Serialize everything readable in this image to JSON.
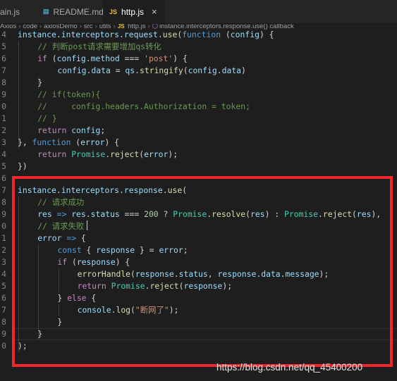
{
  "tabs": [
    {
      "label": "ain.js",
      "icon": "",
      "active": false
    },
    {
      "label": "README.md",
      "icon": "md-file-icon",
      "active": false
    },
    {
      "label": "http.js",
      "icon": "js-file-icon",
      "active": true
    }
  ],
  "tab_icon_text": {
    "md": "▤",
    "js": "JS"
  },
  "close_glyph": "×",
  "breadcrumb": [
    "Axios",
    "code",
    "axiosDemo",
    "src",
    "utils",
    "http.js",
    "instance.interceptors.response.use() callback"
  ],
  "code_lines": [
    {
      "num": "4",
      "indent": 0,
      "tokens": [
        [
          "v",
          "instance"
        ],
        [
          "p",
          "."
        ],
        [
          "v",
          "interceptors"
        ],
        [
          "p",
          "."
        ],
        [
          "v",
          "request"
        ],
        [
          "p",
          "."
        ],
        [
          "f",
          "use"
        ],
        [
          "p",
          "("
        ],
        [
          "k",
          "function"
        ],
        [
          "p",
          " ("
        ],
        [
          "v",
          "config"
        ],
        [
          "p",
          ") {"
        ]
      ]
    },
    {
      "num": "5",
      "indent": 1,
      "tokens": [
        [
          "cm",
          "// 判断post请求需要增加qs转化"
        ]
      ]
    },
    {
      "num": "6",
      "indent": 1,
      "tokens": [
        [
          "c",
          "if"
        ],
        [
          "p",
          " ("
        ],
        [
          "v",
          "config"
        ],
        [
          "p",
          "."
        ],
        [
          "v",
          "method"
        ],
        [
          "p",
          " === "
        ],
        [
          "s",
          "'post'"
        ],
        [
          "p",
          ") {"
        ]
      ]
    },
    {
      "num": "7",
      "indent": 2,
      "tokens": [
        [
          "v",
          "config"
        ],
        [
          "p",
          "."
        ],
        [
          "v",
          "data"
        ],
        [
          "p",
          " = "
        ],
        [
          "v",
          "qs"
        ],
        [
          "p",
          "."
        ],
        [
          "f",
          "stringify"
        ],
        [
          "p",
          "("
        ],
        [
          "v",
          "config"
        ],
        [
          "p",
          "."
        ],
        [
          "v",
          "data"
        ],
        [
          "p",
          ")"
        ]
      ]
    },
    {
      "num": "8",
      "indent": 1,
      "tokens": [
        [
          "p",
          "}"
        ]
      ]
    },
    {
      "num": "9",
      "indent": 1,
      "tokens": [
        [
          "cm",
          "// if(token){"
        ]
      ]
    },
    {
      "num": "0",
      "indent": 1,
      "tokens": [
        [
          "cm",
          "//     config.headers.Authorization = token;"
        ]
      ]
    },
    {
      "num": "1",
      "indent": 1,
      "tokens": [
        [
          "cm",
          "// }"
        ]
      ]
    },
    {
      "num": "2",
      "indent": 1,
      "tokens": [
        [
          "c",
          "return"
        ],
        [
          "p",
          " "
        ],
        [
          "v",
          "config"
        ],
        [
          "p",
          ";"
        ]
      ]
    },
    {
      "num": "3",
      "indent": 0,
      "tokens": [
        [
          "p",
          "}, "
        ],
        [
          "k",
          "function"
        ],
        [
          "p",
          " ("
        ],
        [
          "v",
          "error"
        ],
        [
          "p",
          ") {"
        ]
      ]
    },
    {
      "num": "4",
      "indent": 1,
      "tokens": [
        [
          "c",
          "return"
        ],
        [
          "p",
          " "
        ],
        [
          "cl",
          "Promise"
        ],
        [
          "p",
          "."
        ],
        [
          "f",
          "reject"
        ],
        [
          "p",
          "("
        ],
        [
          "v",
          "error"
        ],
        [
          "p",
          ");"
        ]
      ]
    },
    {
      "num": "5",
      "indent": 0,
      "tokens": [
        [
          "p",
          "})"
        ]
      ]
    },
    {
      "num": "6",
      "indent": 0,
      "tokens": []
    },
    {
      "num": "7",
      "indent": 0,
      "tokens": [
        [
          "v",
          "instance"
        ],
        [
          "p",
          "."
        ],
        [
          "v",
          "interceptors"
        ],
        [
          "p",
          "."
        ],
        [
          "v",
          "response"
        ],
        [
          "p",
          "."
        ],
        [
          "f",
          "use"
        ],
        [
          "p",
          "("
        ]
      ]
    },
    {
      "num": "8",
      "indent": 1,
      "tokens": [
        [
          "cm",
          "// 请求成功"
        ]
      ]
    },
    {
      "num": "9",
      "indent": 1,
      "tokens": [
        [
          "v",
          "res"
        ],
        [
          "p",
          " "
        ],
        [
          "k",
          "=>"
        ],
        [
          "p",
          " "
        ],
        [
          "v",
          "res"
        ],
        [
          "p",
          "."
        ],
        [
          "v",
          "status"
        ],
        [
          "p",
          " === "
        ],
        [
          "n",
          "200"
        ],
        [
          "p",
          " ? "
        ],
        [
          "cl",
          "Promise"
        ],
        [
          "p",
          "."
        ],
        [
          "f",
          "resolve"
        ],
        [
          "p",
          "("
        ],
        [
          "v",
          "res"
        ],
        [
          "p",
          ") : "
        ],
        [
          "cl",
          "Promise"
        ],
        [
          "p",
          "."
        ],
        [
          "f",
          "reject"
        ],
        [
          "p",
          "("
        ],
        [
          "v",
          "res"
        ],
        [
          "p",
          "),"
        ]
      ]
    },
    {
      "num": "0",
      "indent": 1,
      "tokens": [
        [
          "cm",
          "// 请求失败"
        ]
      ]
    },
    {
      "num": "1",
      "indent": 1,
      "tokens": [
        [
          "v",
          "error"
        ],
        [
          "p",
          " "
        ],
        [
          "k",
          "=>"
        ],
        [
          "p",
          " {"
        ]
      ]
    },
    {
      "num": "2",
      "indent": 2,
      "tokens": [
        [
          "k",
          "const"
        ],
        [
          "p",
          " { "
        ],
        [
          "v",
          "response"
        ],
        [
          "p",
          " } = "
        ],
        [
          "v",
          "error"
        ],
        [
          "p",
          ";"
        ]
      ]
    },
    {
      "num": "3",
      "indent": 2,
      "tokens": [
        [
          "c",
          "if"
        ],
        [
          "p",
          " ("
        ],
        [
          "v",
          "response"
        ],
        [
          "p",
          ") {"
        ]
      ]
    },
    {
      "num": "4",
      "indent": 3,
      "tokens": [
        [
          "f",
          "errorHandle"
        ],
        [
          "p",
          "("
        ],
        [
          "v",
          "response"
        ],
        [
          "p",
          "."
        ],
        [
          "v",
          "status"
        ],
        [
          "p",
          ", "
        ],
        [
          "v",
          "response"
        ],
        [
          "p",
          "."
        ],
        [
          "v",
          "data"
        ],
        [
          "p",
          "."
        ],
        [
          "v",
          "message"
        ],
        [
          "p",
          ");"
        ]
      ]
    },
    {
      "num": "5",
      "indent": 3,
      "tokens": [
        [
          "c",
          "return"
        ],
        [
          "p",
          " "
        ],
        [
          "cl",
          "Promise"
        ],
        [
          "p",
          "."
        ],
        [
          "f",
          "reject"
        ],
        [
          "p",
          "("
        ],
        [
          "v",
          "response"
        ],
        [
          "p",
          ");"
        ]
      ]
    },
    {
      "num": "6",
      "indent": 2,
      "tokens": [
        [
          "p",
          "} "
        ],
        [
          "c",
          "else"
        ],
        [
          "p",
          " {"
        ]
      ]
    },
    {
      "num": "7",
      "indent": 3,
      "tokens": [
        [
          "v",
          "console"
        ],
        [
          "p",
          "."
        ],
        [
          "f",
          "log"
        ],
        [
          "p",
          "("
        ],
        [
          "s",
          "\"断网了\""
        ],
        [
          "p",
          ");"
        ]
      ]
    },
    {
      "num": "8",
      "indent": 2,
      "tokens": [
        [
          "p",
          "}"
        ]
      ]
    },
    {
      "num": "9",
      "indent": 1,
      "tokens": [
        [
          "p",
          "}"
        ]
      ]
    },
    {
      "num": "0",
      "indent": 0,
      "tokens": [
        [
          "p",
          ");"
        ]
      ]
    }
  ],
  "watermark": "https://blog.csdn.net/qq_45400200",
  "colors": {
    "background": "#1e1e1e",
    "tabbar": "#252526",
    "highlight_box": "#f2262c",
    "keyword": "#569cd6",
    "control": "#c586c0",
    "variable": "#9cdcfe",
    "function": "#dcdcaa",
    "class": "#4ec9b0",
    "string": "#ce9178",
    "number": "#b5cea8",
    "comment": "#6a9955"
  }
}
